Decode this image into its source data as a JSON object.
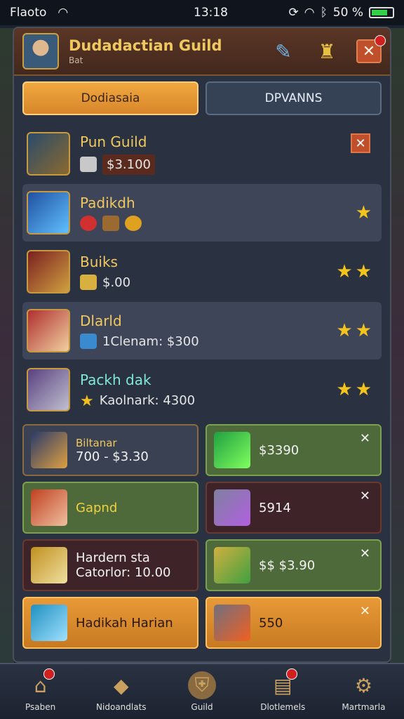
{
  "status_bar": {
    "carrier": "Flaoto",
    "time": "13:18",
    "battery": "50 %"
  },
  "header": {
    "title": "Dudadactian Guild",
    "subtitle": "Bat"
  },
  "tabs": [
    {
      "label": "Dodiasaia",
      "active": true
    },
    {
      "label": "DPVANNS",
      "active": false
    }
  ],
  "guilds": [
    {
      "name": "Pun Guild",
      "detail": "$3.100",
      "stars": 0,
      "bg": "dark"
    },
    {
      "name": "Padikdh",
      "detail": "",
      "stars": 1,
      "bg": "light"
    },
    {
      "name": "Buiks",
      "detail": "$.00",
      "stars": 2,
      "bg": "dark"
    },
    {
      "name": "Dlarld",
      "detail": "1Clenam: $300",
      "stars": 2,
      "bg": "light"
    },
    {
      "name": "Packh dak",
      "detail": "Kaolnark: 4300",
      "stars": 2,
      "bg": "dark"
    }
  ],
  "offers": [
    {
      "title": "Biltanar",
      "line": "700 - $3.30",
      "style": "slate"
    },
    {
      "line": "$3390",
      "style": "green"
    },
    {
      "line": "Gapnd",
      "style": "green"
    },
    {
      "line": "5914",
      "style": "maroon"
    },
    {
      "title": "Hardern sta",
      "line": "Catorlor: 10.00",
      "style": "maroon"
    },
    {
      "line": "$$ $3.90",
      "style": "green"
    },
    {
      "line": "Hadikah Harian",
      "style": "orange"
    },
    {
      "line": "550",
      "style": "orange"
    }
  ],
  "nav": [
    {
      "label": "Psaben"
    },
    {
      "label": "Nidoandlats"
    },
    {
      "label": "Guild"
    },
    {
      "label": "Dlotlemels"
    },
    {
      "label": "Martmarla"
    }
  ]
}
